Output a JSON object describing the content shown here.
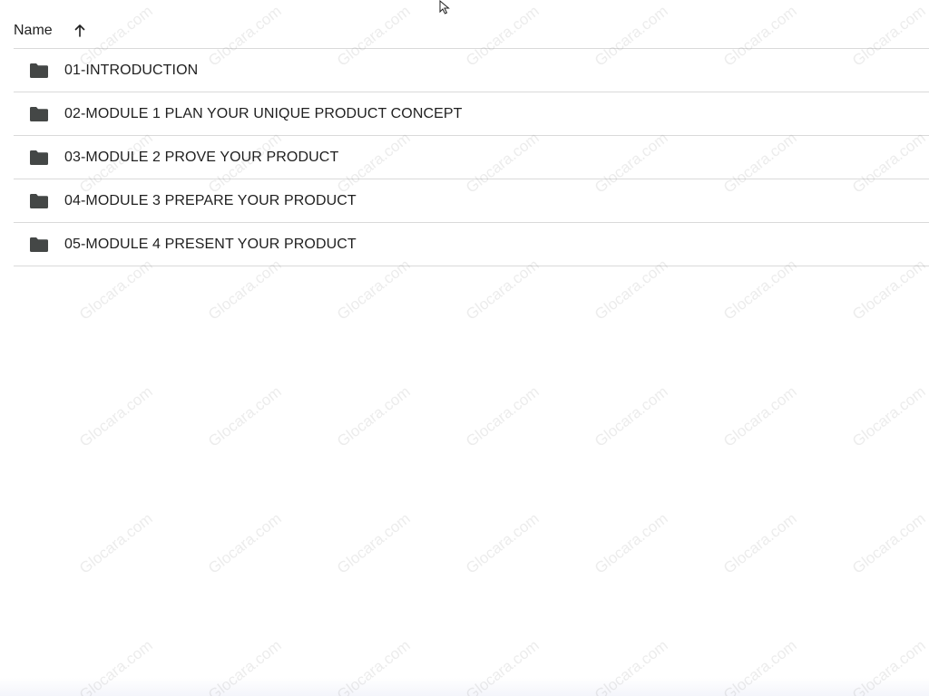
{
  "header": {
    "name_label": "Name",
    "sort_icon": "arrow-up-icon"
  },
  "folders": [
    {
      "label": "01-INTRODUCTION",
      "icon": "folder-icon"
    },
    {
      "label": "02-MODULE 1 PLAN YOUR UNIQUE PRODUCT CONCEPT",
      "icon": "folder-icon"
    },
    {
      "label": "03-MODULE 2 PROVE YOUR PRODUCT",
      "icon": "folder-icon"
    },
    {
      "label": "04-MODULE 3 PREPARE YOUR PRODUCT",
      "icon": "folder-icon"
    },
    {
      "label": "05-MODULE 4 PRESENT YOUR PRODUCT",
      "icon": "folder-icon"
    }
  ],
  "watermark": {
    "text": "Glocara.com"
  },
  "colors": {
    "text": "#1f1f1f",
    "divider": "#dadada",
    "folder_icon": "#444746",
    "background": "#ffffff"
  }
}
